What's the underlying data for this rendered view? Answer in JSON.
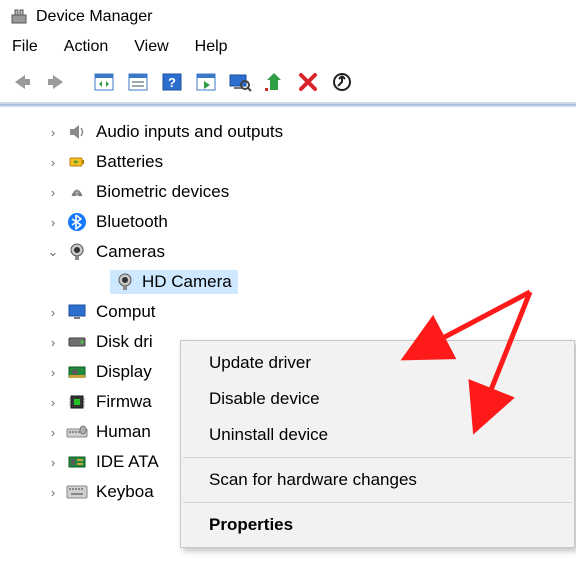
{
  "window": {
    "title": "Device Manager"
  },
  "menubar": {
    "items": [
      "File",
      "Action",
      "View",
      "Help"
    ]
  },
  "toolbar": {
    "buttons": [
      "back-icon",
      "forward-icon",
      "sep",
      "show-hide-tree-icon",
      "properties-window-icon",
      "help-icon",
      "action-window-icon",
      "scan-monitor-icon",
      "update-up-icon",
      "delete-x-icon",
      "scan-hardware-icon"
    ]
  },
  "tree": {
    "nodes": [
      {
        "expander": "›",
        "icon": "speaker-icon",
        "label": "Audio inputs and outputs"
      },
      {
        "expander": "›",
        "icon": "battery-icon",
        "label": "Batteries"
      },
      {
        "expander": "›",
        "icon": "fingerprint-icon",
        "label": "Biometric devices"
      },
      {
        "expander": "›",
        "icon": "bluetooth-icon",
        "label": "Bluetooth"
      },
      {
        "expander": "⌄",
        "icon": "camera-icon",
        "label": "Cameras",
        "children": [
          {
            "icon": "camera-icon",
            "label": "HD Camera",
            "selected": true
          }
        ]
      },
      {
        "expander": "›",
        "icon": "monitor-icon",
        "label": "Comput"
      },
      {
        "expander": "›",
        "icon": "drive-icon",
        "label": "Disk dri"
      },
      {
        "expander": "›",
        "icon": "gpu-icon",
        "label": "Display"
      },
      {
        "expander": "›",
        "icon": "chip-icon",
        "label": "Firmwa"
      },
      {
        "expander": "›",
        "icon": "hid-icon",
        "label": "Human"
      },
      {
        "expander": "›",
        "icon": "ide-icon",
        "label": "IDE ATA"
      },
      {
        "expander": "›",
        "icon": "keyboard-icon",
        "label": "Keyboa"
      }
    ]
  },
  "context_menu": {
    "items": [
      {
        "label": "Update driver"
      },
      {
        "label": "Disable device"
      },
      {
        "label": "Uninstall device"
      },
      {
        "sep": true
      },
      {
        "label": "Scan for hardware changes"
      },
      {
        "sep": true
      },
      {
        "label": "Properties",
        "bold": true
      }
    ]
  }
}
